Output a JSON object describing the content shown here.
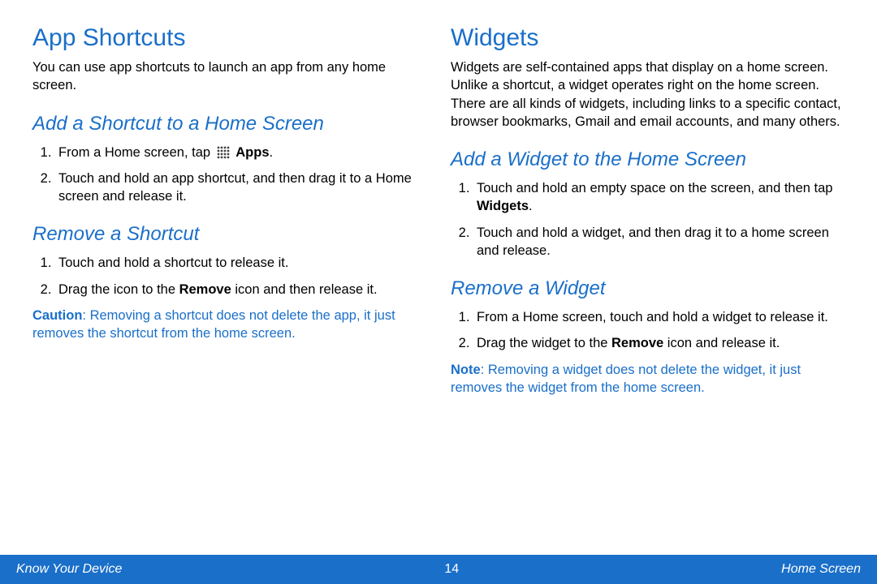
{
  "left": {
    "title": "App Shortcuts",
    "intro": "You can use app shortcuts to launch an app from any home screen.",
    "add": {
      "heading": "Add a Shortcut to a Home Screen",
      "step1_pre": "From a Home screen, tap ",
      "step1_bold": "Apps",
      "step1_post": ".",
      "step2": "Touch and hold an app shortcut, and then drag it to a Home screen and release it."
    },
    "remove": {
      "heading": "Remove a Shortcut",
      "step1": "Touch and hold a shortcut to release it.",
      "step2_pre": "Drag the icon to the ",
      "step2_bold": "Remove",
      "step2_post": " icon and then release it."
    },
    "caution_label": "Caution",
    "caution_text": ": Removing a shortcut does not delete the app, it just removes the shortcut from the home screen."
  },
  "right": {
    "title": "Widgets",
    "intro": "Widgets are self-contained apps that display on a home screen. Unlike a shortcut, a widget operates right on the home screen. There are all kinds of widgets, including links to a specific contact, browser bookmarks, Gmail and email accounts, and many others.",
    "add": {
      "heading": "Add a Widget to the Home Screen",
      "step1_pre": "Touch and hold an empty space on the screen, and then tap ",
      "step1_bold": "Widgets",
      "step1_post": ".",
      "step2": "Touch and hold a widget, and then drag it to a home screen and release."
    },
    "remove": {
      "heading": "Remove a Widget",
      "step1": "From a Home screen, touch and hold a widget to release it.",
      "step2_pre": "Drag the widget to the ",
      "step2_bold": "Remove",
      "step2_post": " icon and release it."
    },
    "note_label": "Note",
    "note_text": ": Removing a widget does not delete the widget, it just removes the widget from the home screen."
  },
  "footer": {
    "left": "Know Your Device",
    "page": "14",
    "right": "Home Screen"
  }
}
